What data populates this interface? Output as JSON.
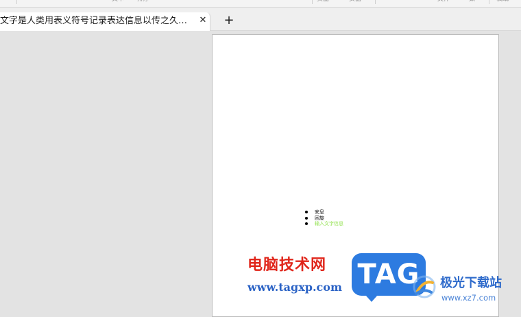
{
  "toolbar": {
    "fragments": [
      "文本",
      "排序",
      "页面",
      "页面",
      "文件",
      "数",
      "稿纸"
    ]
  },
  "tabs": [
    {
      "title": "文字是人类用表义符号记录表达信息以传之久远的方...",
      "close_glyph": "✕"
    }
  ],
  "new_tab_glyph": "+",
  "document": {
    "bullets": [
      {
        "text": "安息"
      },
      {
        "text": "困旋"
      },
      {
        "text": "输入文字信息",
        "color": "#8fe04a"
      }
    ]
  },
  "watermark": {
    "site_name_cn": "电脑技术网",
    "site_url": "www.tagxp.com",
    "badge": "TAG",
    "brand_cn": "极光下载站",
    "brand_url": "www.xz7.com",
    "colors": {
      "red": "#e0261b",
      "blue": "#2a62c5",
      "badge": "#2d7be0"
    }
  }
}
